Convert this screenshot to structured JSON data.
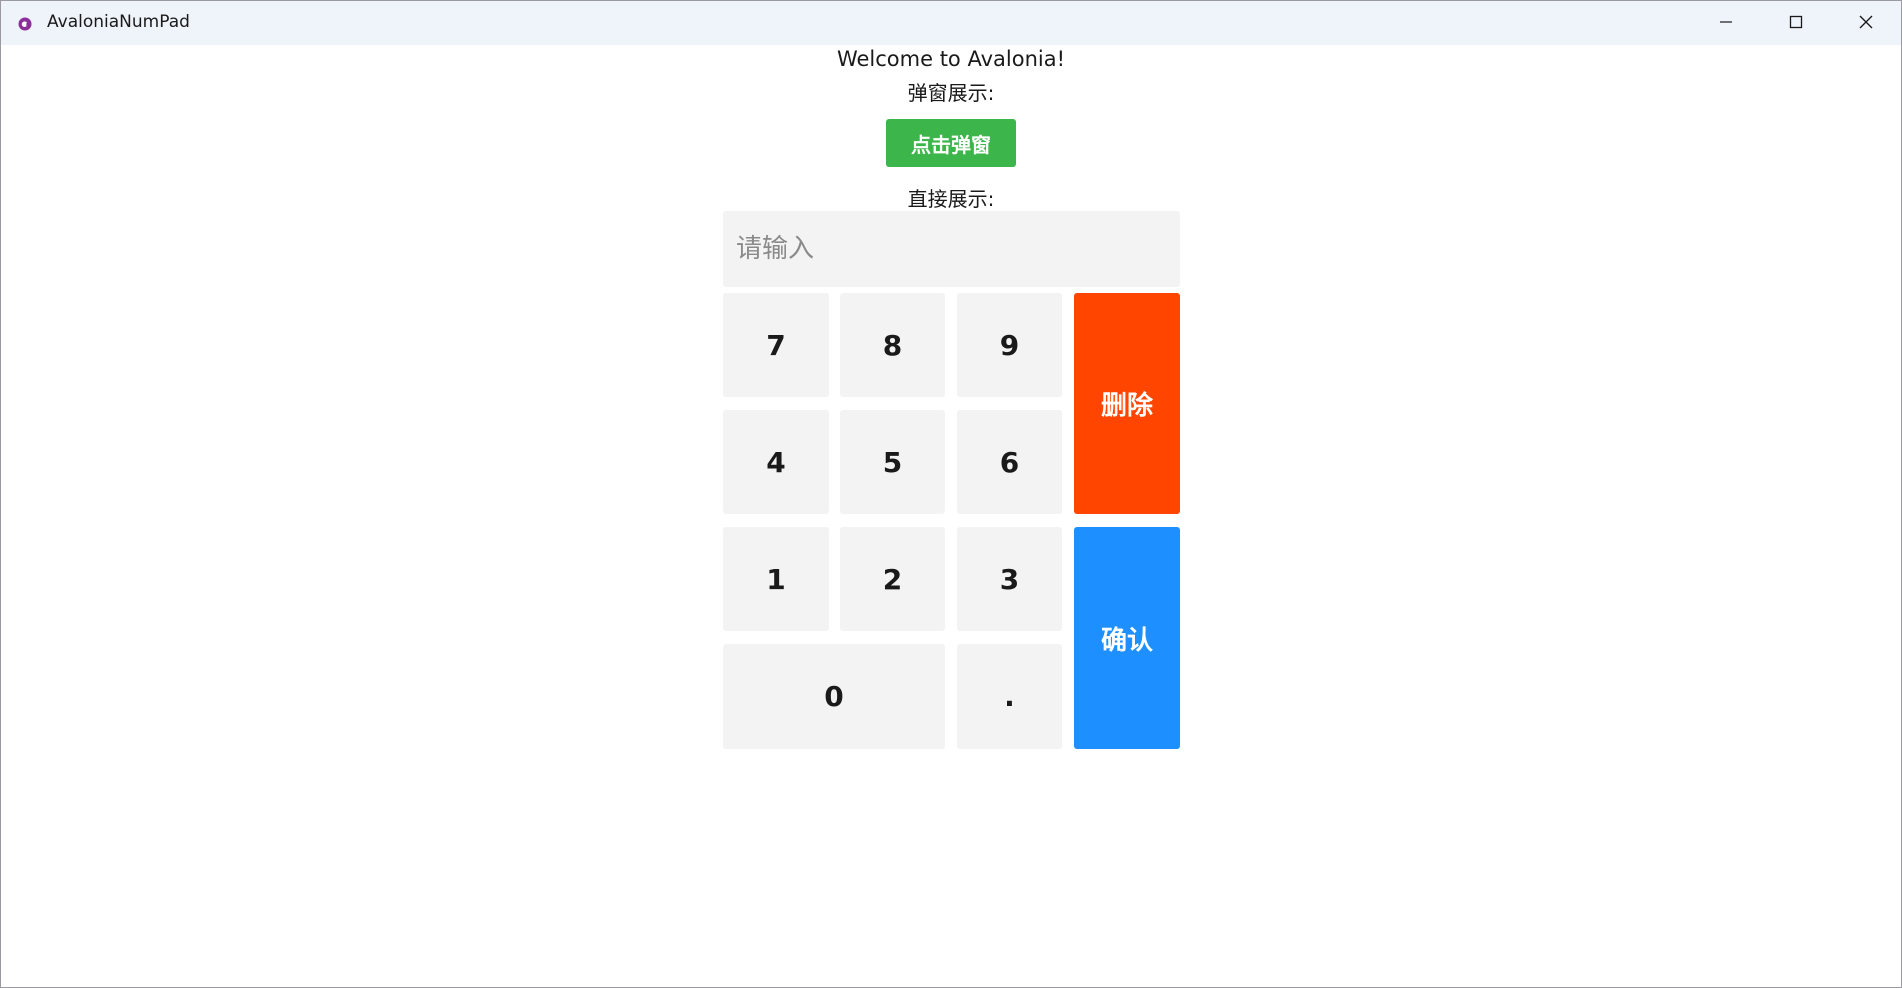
{
  "window": {
    "title": "AvaloniaNumPad",
    "icon": "avalonia-logo-icon",
    "controls": [
      "minimize-icon",
      "maximize-icon",
      "close-icon"
    ]
  },
  "main": {
    "welcome": "Welcome to Avalonia!",
    "popup_label": "弹窗展示:",
    "popup_button": "点击弹窗",
    "direct_label": "直接展示:"
  },
  "numpad": {
    "input_placeholder": "请输入",
    "input_value": "",
    "keys": {
      "k7": "7",
      "k8": "8",
      "k9": "9",
      "k4": "4",
      "k5": "5",
      "k6": "6",
      "k1": "1",
      "k2": "2",
      "k3": "3",
      "k0": "0",
      "dot": "."
    },
    "delete_label": "删除",
    "confirm_label": "确认"
  },
  "colors": {
    "titlebar_bg": "#eff3fa",
    "popup_button_bg": "#3cb54a",
    "key_bg": "#f3f3f3",
    "delete_bg": "#ff4500",
    "confirm_bg": "#1e8fff",
    "logo": "#8b2f9a"
  }
}
